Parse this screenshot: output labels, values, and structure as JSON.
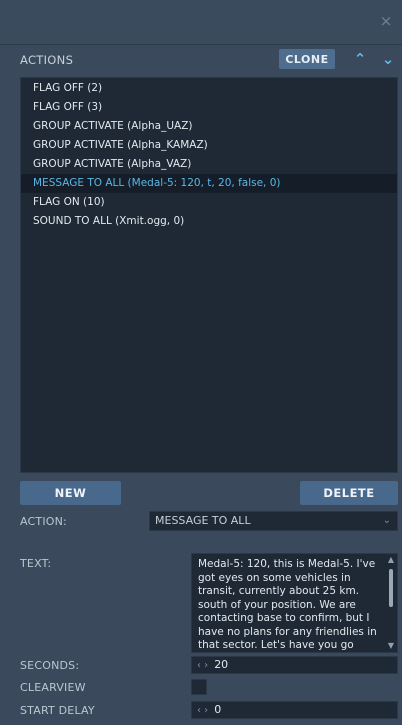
{
  "window": {
    "close_glyph": "×"
  },
  "actions": {
    "section_label": "ACTIONS",
    "clone_label": "CLONE",
    "move_up_glyph": "⌃",
    "move_down_glyph": "⌄",
    "items": [
      {
        "label": "FLAG OFF (2)",
        "selected": false
      },
      {
        "label": "FLAG OFF (3)",
        "selected": false
      },
      {
        "label": "GROUP ACTIVATE (Alpha_UAZ)",
        "selected": false
      },
      {
        "label": "GROUP ACTIVATE (Alpha_KAMAZ)",
        "selected": false
      },
      {
        "label": "GROUP ACTIVATE (Alpha_VAZ)",
        "selected": false
      },
      {
        "label": "MESSAGE TO ALL (Medal-5: 120, t, 20, false, 0)",
        "selected": true
      },
      {
        "label": "FLAG ON (10)",
        "selected": false
      },
      {
        "label": "SOUND TO ALL (Xmit.ogg, 0)",
        "selected": false
      }
    ],
    "new_label": "NEW",
    "delete_label": "DELETE"
  },
  "form": {
    "action_label": "ACTION:",
    "action_value": "MESSAGE TO ALL",
    "text_label": "TEXT:",
    "text_value": "Medal-5: 120, this is Medal-5. I've got eyes on some vehicles in transit, currently about 25 km. south of your position. We are contacting base to confirm, but I have no plans for any friendlies in that sector. Let's have you go",
    "seconds_label": "SECONDS:",
    "seconds_value": "20",
    "clearview_label": "CLEARVIEW",
    "clearview_checked": false,
    "start_delay_label": "START DELAY",
    "start_delay_value": "0",
    "stepper_glyph": "‹ ›"
  },
  "colors": {
    "panel_bg": "#3a4a5c",
    "list_bg": "#1e2935",
    "accent": "#5ab6e6",
    "button_bg": "#48698c"
  }
}
